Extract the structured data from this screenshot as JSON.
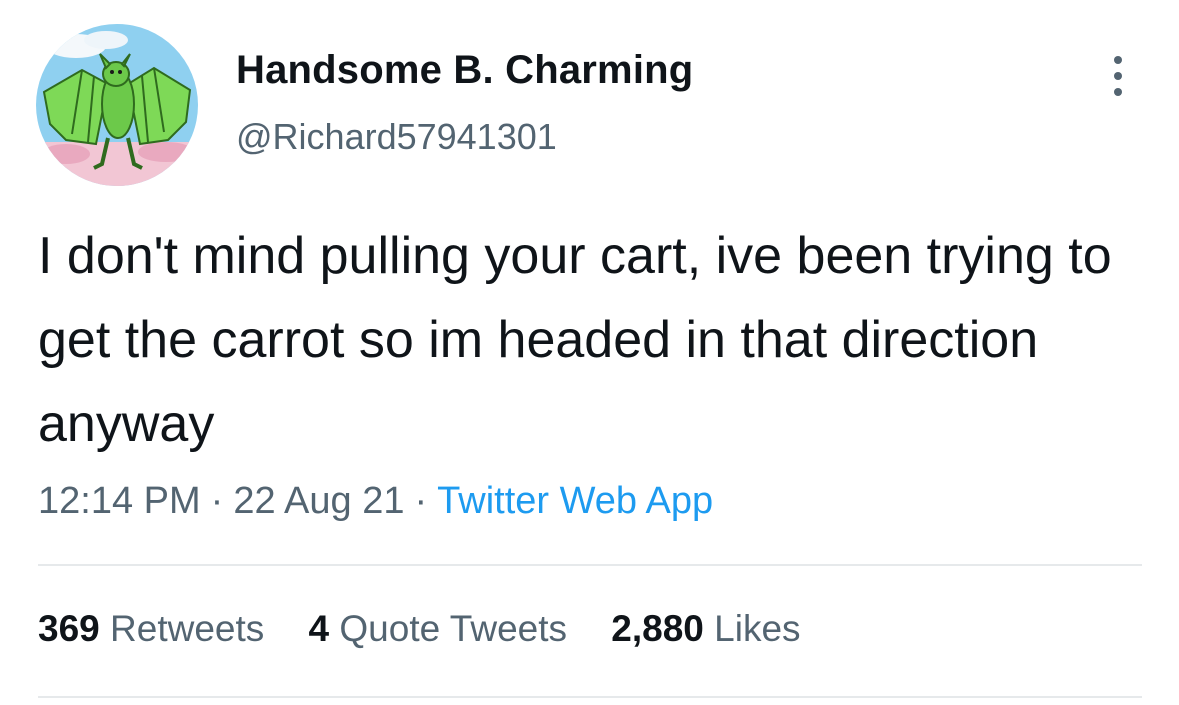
{
  "author": {
    "display_name": "Handsome B. Charming",
    "handle": "@Richard57941301",
    "avatar_icon": "cartoon-bat-avatar-icon"
  },
  "tweet": {
    "text": "I don't mind pulling your cart, ive been trying to get the carrot so im headed in that direction anyway",
    "time": "12:14 PM",
    "separator": "·",
    "date": "22 Aug 21",
    "source": "Twitter Web App"
  },
  "stats": {
    "retweets": {
      "count": "369",
      "label": "Retweets"
    },
    "quote_tweets": {
      "count": "4",
      "label": "Quote Tweets"
    },
    "likes": {
      "count": "2,880",
      "label": "Likes"
    }
  },
  "icons": {
    "more": "more-options-icon"
  },
  "colors": {
    "text_primary": "#0f1419",
    "text_secondary": "#536471",
    "link": "#1d9bf0",
    "divider": "#e6e9eb"
  }
}
